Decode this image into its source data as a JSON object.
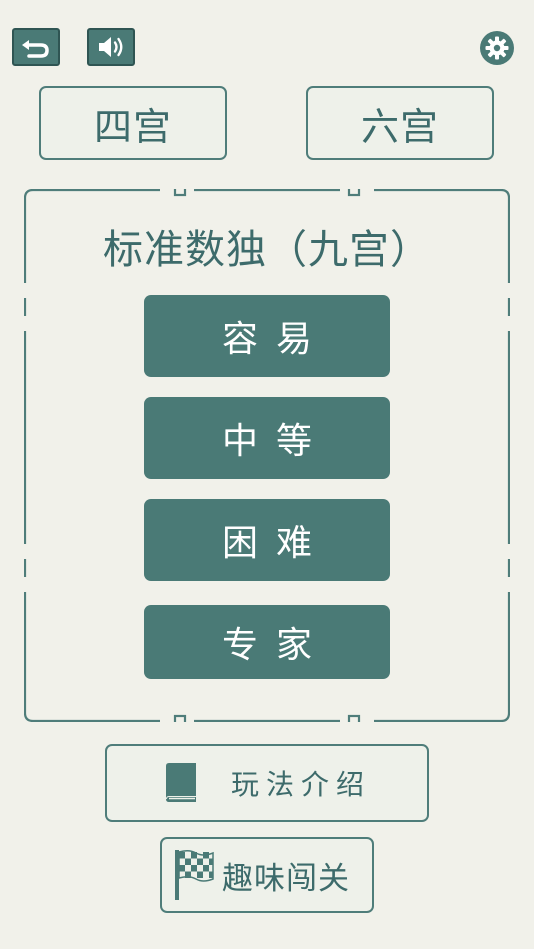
{
  "topbar": {
    "back_icon": "back-arrow-icon",
    "sound_icon": "speaker-icon",
    "settings_icon": "gear-icon"
  },
  "modes": {
    "four": "四宫",
    "six": "六宫"
  },
  "panel": {
    "title": "标准数独（九宫）",
    "difficulties": [
      "容易",
      "中等",
      "困难",
      "专家"
    ]
  },
  "howto": {
    "label": "玩法介绍",
    "icon": "book-icon"
  },
  "challenge": {
    "label": "趣味闯关",
    "icon": "checkered-flag-icon"
  },
  "colors": {
    "accent": "#4a7a76",
    "text": "#3d6b6b",
    "background": "#f1f1ea"
  }
}
